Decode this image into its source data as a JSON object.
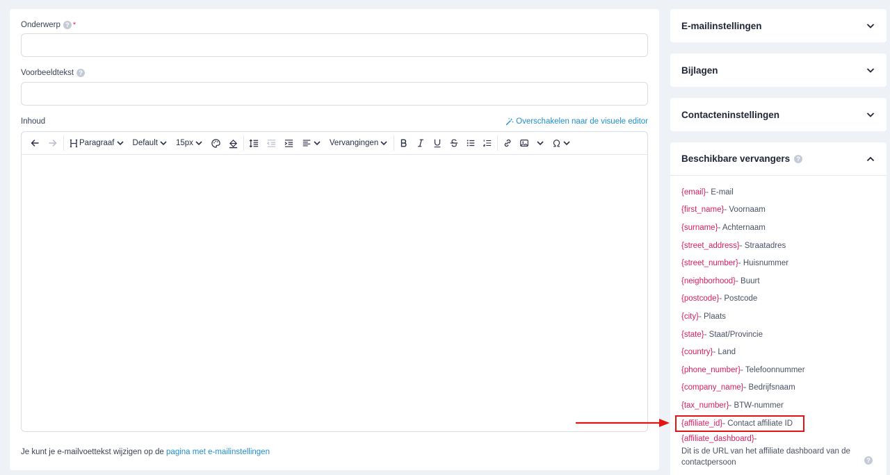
{
  "form": {
    "subject_label": "Onderwerp",
    "required_mark": "*",
    "preview_label": "Voorbeeldtekst",
    "content_label": "Inhoud",
    "switch_editor": "Overschakelen naar de visuele editor",
    "help_glyph": "?"
  },
  "toolbar": {
    "heading_label": "Paragraaf",
    "font_family": "Default",
    "font_size": "15px",
    "replacements": "Vervangingen"
  },
  "footer": {
    "text": "Je kunt je e-mailvoettekst wijzigen op de",
    "link": "pagina met e-mailinstellingen"
  },
  "sidebar": {
    "email_settings": "E-mailinstellingen",
    "attachments": "Bijlagen",
    "contact_settings": "Contacteninstellingen",
    "available_vars": "Beschikbare vervangers"
  },
  "variables": [
    {
      "key": "{email}",
      "desc": " - E-mail"
    },
    {
      "key": "{first_name}",
      "desc": " - Voornaam"
    },
    {
      "key": "{surname}",
      "desc": " - Achternaam"
    },
    {
      "key": "{street_address}",
      "desc": " - Straatadres"
    },
    {
      "key": "{street_number}",
      "desc": " - Huisnummer"
    },
    {
      "key": "{neighborhood}",
      "desc": " - Buurt"
    },
    {
      "key": "{postcode}",
      "desc": " - Postcode"
    },
    {
      "key": "{city}",
      "desc": " - Plaats"
    },
    {
      "key": "{state}",
      "desc": " - Staat/Provincie"
    },
    {
      "key": "{country}",
      "desc": " - Land"
    },
    {
      "key": "{phone_number}",
      "desc": " - Telefoonnummer"
    },
    {
      "key": "{company_name}",
      "desc": " - Bedrijfsnaam"
    },
    {
      "key": "{tax_number}",
      "desc": " - BTW-nummer"
    },
    {
      "key": "{affiliate_id}",
      "desc": " - Contact affiliate ID"
    }
  ],
  "last_variable": {
    "key": "{affiliate_dashboard}",
    "dash": " -",
    "desc": "Dit is de URL van het affiliate dashboard van de contactpersoon"
  },
  "colors": {
    "accent": "#1f8fd1",
    "variable_key": "#d81b60",
    "annotation": "#e51212"
  }
}
